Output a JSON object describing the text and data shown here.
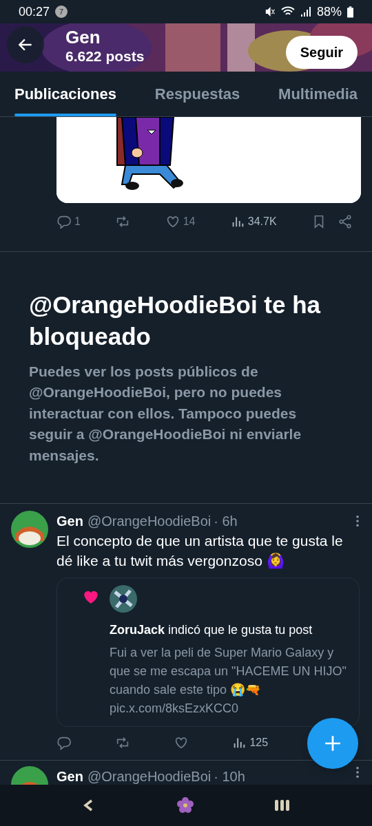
{
  "status_bar": {
    "time": "00:27",
    "notification_count": "7",
    "battery": "88%"
  },
  "header": {
    "name": "Gen",
    "posts": "6.622 posts",
    "follow_button": "Seguir"
  },
  "tabs": [
    {
      "label": "Publicaciones",
      "selected": true
    },
    {
      "label": "Respuestas",
      "selected": false
    },
    {
      "label": "Multimedia",
      "selected": false
    }
  ],
  "previous_post": {
    "actions": {
      "replies": "1",
      "likes": "14",
      "views": "34.7K"
    }
  },
  "blocked_notice": {
    "title": "@OrangeHoodieBoi te ha bloqueado",
    "text": "Puedes ver los posts públicos de @OrangeHoodieBoi, pero no puedes interactuar con ellos. Tampoco puedes seguir a @OrangeHoodieBoi ni enviarle mensajes."
  },
  "posts": [
    {
      "name": "Gen",
      "handle": "@OrangeHoodieBoi",
      "time": "· 6h",
      "text": "El concepto de que un artista que te gusta le dé like a tu twit más vergonzoso 🙆‍♀️",
      "liked_notice": {
        "user": "ZoruJack",
        "action": "indicó que le gusta tu post",
        "quote": "Fui a ver la peli de Super Mario Galaxy y que se me escapa un \"HACEME UN HIJO\" cuando sale este tipo 😭🔫 pic.x.com/8ksEzxKCC0"
      },
      "actions": {
        "views": "125"
      }
    },
    {
      "name": "Gen",
      "handle": "@OrangeHoodieBoi",
      "time": "· 10h"
    }
  ]
}
